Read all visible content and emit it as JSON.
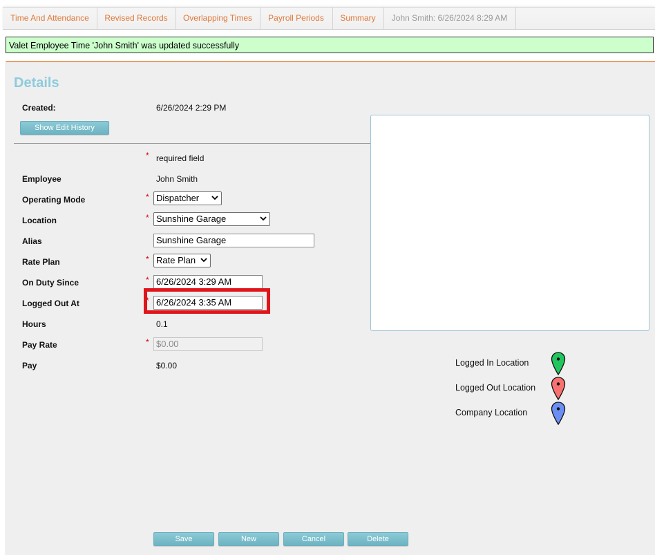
{
  "tabs": [
    {
      "label": "Time And Attendance"
    },
    {
      "label": "Revised Records"
    },
    {
      "label": "Overlapping Times"
    },
    {
      "label": "Payroll Periods"
    },
    {
      "label": "Summary"
    },
    {
      "label": "John Smith: 6/26/2024 8:29 AM"
    }
  ],
  "message": "Valet Employee Time 'John Smith' was updated successfully",
  "details": {
    "heading": "Details",
    "created_label": "Created:",
    "created_value": "6/26/2024 2:29 PM",
    "show_history_label": "Show Edit History",
    "required_star": "*",
    "required_text": "required field"
  },
  "form": {
    "employee_label": "Employee",
    "employee_value": "John Smith",
    "operating_mode_label": "Operating Mode",
    "operating_mode_value": "Dispatcher",
    "location_label": "Location",
    "location_value": "Sunshine Garage",
    "alias_label": "Alias",
    "alias_value": "Sunshine Garage",
    "rate_plan_label": "Rate Plan",
    "rate_plan_value": "Rate Plan",
    "on_duty_label": "On Duty Since",
    "on_duty_value": "6/26/2024 3:29 AM",
    "logged_out_label": "Logged Out At",
    "logged_out_value": "6/26/2024 3:35 AM",
    "hours_label": "Hours",
    "hours_value": "0.1",
    "pay_rate_label": "Pay Rate",
    "pay_rate_value": "$0.00",
    "pay_label": "Pay",
    "pay_value": "$0.00"
  },
  "legend": {
    "logged_in": "Logged In Location",
    "logged_out": "Logged Out Location",
    "company": "Company Location",
    "colors": {
      "logged_in": "#22c55e",
      "logged_out": "#f87171",
      "company": "#6b8ef5"
    }
  },
  "actions": {
    "save": "Save",
    "new": "New",
    "cancel": "Cancel",
    "delete": "Delete"
  }
}
